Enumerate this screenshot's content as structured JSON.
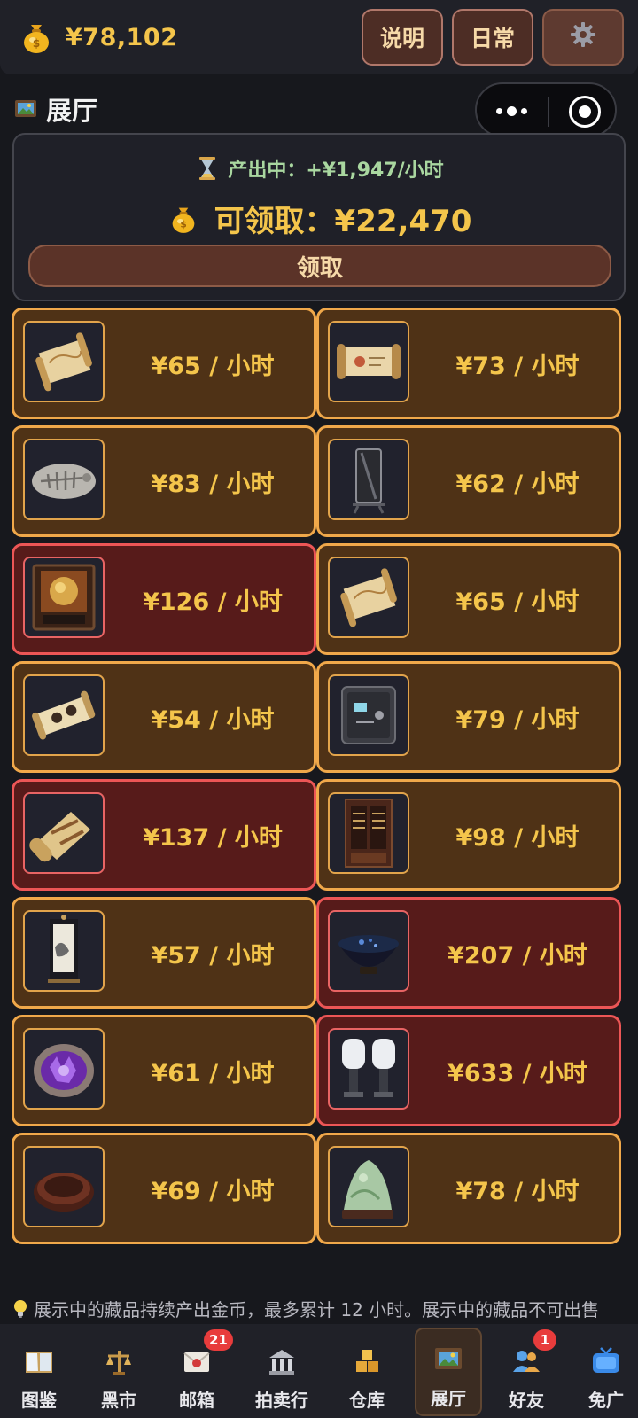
{
  "topbar": {
    "coins": "¥78,102",
    "help_label": "说明",
    "daily_label": "日常",
    "settings_icon": "gear-icon"
  },
  "section": {
    "title": "展厅"
  },
  "production": {
    "rate_text": "产出中：+¥1,947/小时",
    "claimable_text": "可领取：¥22,470",
    "claim_label": "领取"
  },
  "exhibits": [
    {
      "rate": "¥65 / 小时",
      "item": "scroll-map",
      "rare": false
    },
    {
      "rate": "¥73 / 小时",
      "item": "open-scroll",
      "rare": false
    },
    {
      "rate": "¥83 / 小时",
      "item": "fossil",
      "rare": false
    },
    {
      "rate": "¥62 / 小时",
      "item": "standing-mirror",
      "rare": false
    },
    {
      "rate": "¥126 / 小时",
      "item": "framed-embroidery",
      "rare": true
    },
    {
      "rate": "¥65 / 小时",
      "item": "scroll-map",
      "rare": false
    },
    {
      "rate": "¥54 / 小时",
      "item": "painted-scroll",
      "rare": false
    },
    {
      "rate": "¥79 / 小时",
      "item": "safe",
      "rare": false
    },
    {
      "rate": "¥137 / 小时",
      "item": "rolled-parchment",
      "rare": true
    },
    {
      "rate": "¥98 / 小时",
      "item": "wine-cabinet",
      "rare": false
    },
    {
      "rate": "¥57 / 小时",
      "item": "hanging-painting",
      "rare": false
    },
    {
      "rate": "¥207 / 小时",
      "item": "tea-bowl",
      "rare": true
    },
    {
      "rate": "¥61 / 小时",
      "item": "amethyst-geode",
      "rare": false
    },
    {
      "rate": "¥633 / 小时",
      "item": "outboard-engines",
      "rare": true
    },
    {
      "rate": "¥69 / 小时",
      "item": "inkstone-box",
      "rare": false
    },
    {
      "rate": "¥78 / 小时",
      "item": "jade-mountain",
      "rare": false
    }
  ],
  "footnote": "展示中的藏品持续产出金币，最多累计 12 小时。展示中的藏品不可出售",
  "nav": [
    {
      "label": "图鉴",
      "icon": "book-icon",
      "badge": ""
    },
    {
      "label": "黑市",
      "icon": "scale-icon",
      "badge": ""
    },
    {
      "label": "邮箱",
      "icon": "mail-icon",
      "badge": "21"
    },
    {
      "label": "拍卖行",
      "icon": "bank-icon",
      "badge": ""
    },
    {
      "label": "仓库",
      "icon": "boxes-icon",
      "badge": ""
    },
    {
      "label": "展厅",
      "icon": "gallery-icon",
      "badge": ""
    },
    {
      "label": "好友",
      "icon": "friends-icon",
      "badge": "1"
    },
    {
      "label": "免广",
      "icon": "tv-icon",
      "badge": ""
    }
  ],
  "colors": {
    "accent_gold": "#f4c54b",
    "card_normal_border": "#f0a84a",
    "card_rare_border": "#ec5656",
    "rate_green": "#a9d7a0",
    "badge_red": "#e83c3c"
  }
}
